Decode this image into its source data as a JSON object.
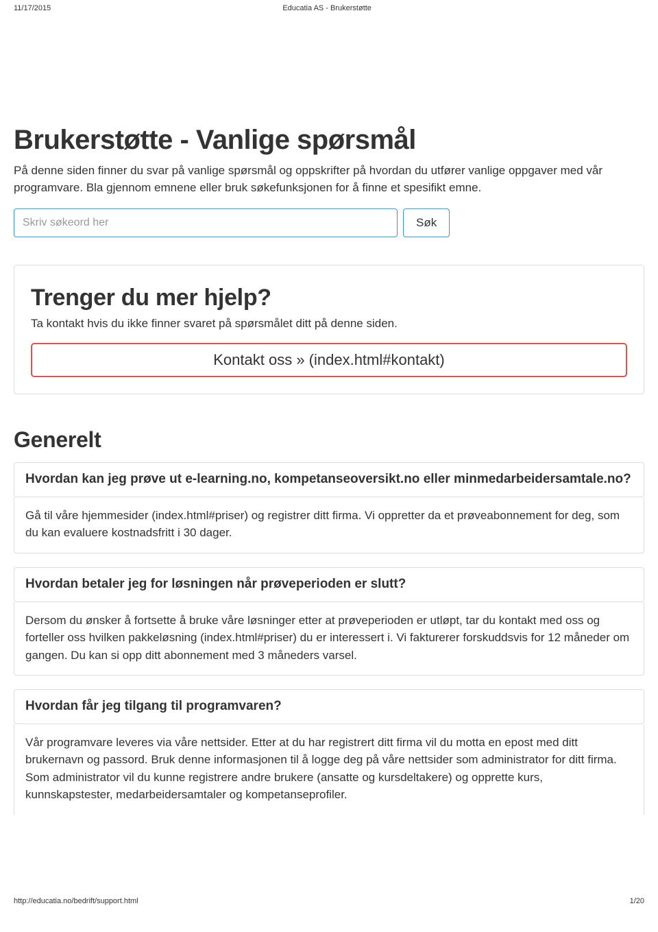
{
  "print": {
    "date": "11/17/2015",
    "title": "Educatia AS - Brukerstøtte",
    "url": "http://educatia.no/bedrift/support.html",
    "page": "1/20"
  },
  "page": {
    "title": "Brukerstøtte - Vanlige spørsmål",
    "intro": "På denne siden finner du svar på vanlige spørsmål og oppskrifter på hvordan du utfører vanlige oppgaver med vår programvare. Bla gjennom emnene eller bruk søkefunksjonen for å finne et spesifikt emne."
  },
  "search": {
    "placeholder": "Skriv søkeord her",
    "button": "Søk"
  },
  "help": {
    "title": "Trenger du mer hjelp?",
    "subtitle": "Ta kontakt hvis du ikke finner svaret på spørsmålet ditt på denne siden.",
    "button": "Kontakt oss » (index.html#kontakt)"
  },
  "section": {
    "title": "Generelt"
  },
  "faq": [
    {
      "q": "Hvordan kan jeg prøve ut e-learning.no, kompetanseoversikt.no eller minmedarbeidersamtale.no?",
      "a": "Gå til våre hjemmesider (index.html#priser) og registrer ditt firma. Vi oppretter da et prøveabonnement for deg, som du kan evaluere kostnadsfritt i 30 dager."
    },
    {
      "q": "Hvordan betaler jeg for løsningen når prøveperioden er slutt?",
      "a": "Dersom du ønsker å fortsette å bruke våre løsninger etter at prøveperioden er utløpt, tar du kontakt med oss og forteller oss hvilken pakkeløsning (index.html#priser) du er interessert i. Vi fakturerer forskuddsvis for 12 måneder om gangen. Du kan si opp ditt abonnement med 3 måneders varsel."
    },
    {
      "q": "Hvordan får jeg tilgang til programvaren?",
      "a": "Vår programvare leveres via våre nettsider. Etter at du har registrert ditt firma vil du motta en epost med ditt brukernavn og passord. Bruk denne informasjonen til å logge deg på våre nettsider som administrator for ditt firma. Som administrator vil du kunne registrere andre brukere (ansatte og kursdeltakere) og opprette kurs, kunnskapstester, medarbeidersamtaler og kompetanseprofiler."
    }
  ]
}
